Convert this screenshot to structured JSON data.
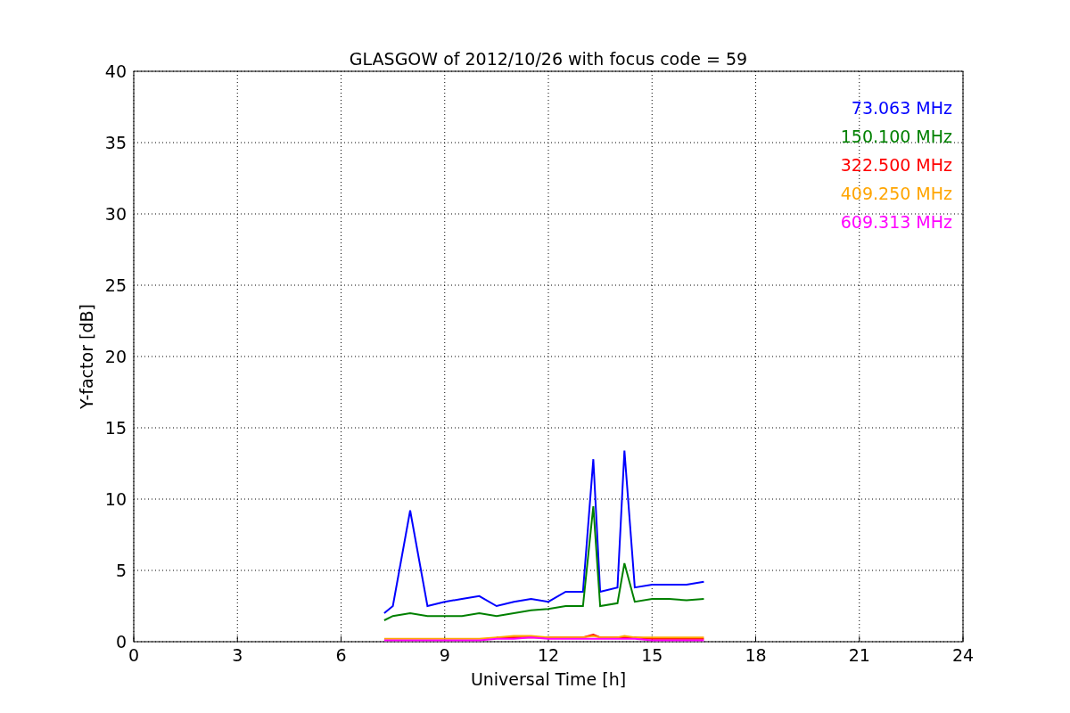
{
  "chart_data": {
    "type": "line",
    "title": "GLASGOW of 2012/10/26 with focus code = 59",
    "xlabel": "Universal Time [h]",
    "ylabel": "Y-factor [dB]",
    "x": [
      7.25,
      7.5,
      8,
      8.5,
      9,
      9.5,
      10,
      10.5,
      11,
      11.5,
      12,
      12.5,
      13,
      13.3,
      13.5,
      14,
      14.2,
      14.5,
      15,
      15.5,
      16,
      16.5
    ],
    "series": [
      {
        "name": "73.063 MHz",
        "color": "#0000ff",
        "values": [
          2,
          2.5,
          9.2,
          2.5,
          2.8,
          3,
          3.2,
          2.5,
          2.8,
          3,
          2.8,
          3.5,
          3.5,
          12.8,
          3.5,
          3.8,
          13.4,
          3.8,
          4,
          4,
          4,
          4.2
        ]
      },
      {
        "name": "150.100 MHz",
        "color": "#008000",
        "values": [
          1.5,
          1.8,
          2,
          1.8,
          1.8,
          1.8,
          2,
          1.8,
          2,
          2.2,
          2.3,
          2.5,
          2.5,
          9.5,
          2.5,
          2.7,
          5.5,
          2.8,
          3,
          3,
          2.9,
          3
        ]
      },
      {
        "name": "322.500 MHz",
        "color": "#ff0000",
        "values": [
          null,
          null,
          null,
          null,
          null,
          null,
          null,
          0.3,
          0.3,
          0.3,
          0.3,
          0.3,
          0.3,
          0.5,
          0.3,
          0.3,
          0.3,
          0.3,
          0.2,
          0.2,
          0.2,
          0.2
        ]
      },
      {
        "name": "409.250 MHz",
        "color": "#ffa500",
        "values": [
          0.2,
          0.2,
          0.2,
          0.2,
          0.2,
          0.2,
          0.2,
          0.3,
          0.4,
          0.4,
          0.3,
          0.3,
          0.3,
          0.4,
          0.3,
          0.3,
          0.4,
          0.3,
          0.3,
          0.3,
          0.3,
          0.3
        ]
      },
      {
        "name": "609.313 MHz",
        "color": "#ff00ff",
        "values": [
          0.1,
          0.1,
          0.1,
          0.1,
          0.1,
          0.1,
          0.1,
          0.2,
          0.2,
          0.3,
          0.2,
          0.2,
          0.2,
          0.2,
          0.2,
          0.2,
          0.2,
          0.2,
          0.1,
          0.1,
          0.1,
          0.1
        ]
      }
    ],
    "grid": true,
    "xlim": [
      0,
      24
    ],
    "ylim": [
      0,
      40
    ],
    "xticks": [
      0,
      3,
      6,
      9,
      12,
      15,
      18,
      21,
      24
    ],
    "yticks": [
      0,
      5,
      10,
      15,
      20,
      25,
      30,
      35,
      40
    ]
  }
}
